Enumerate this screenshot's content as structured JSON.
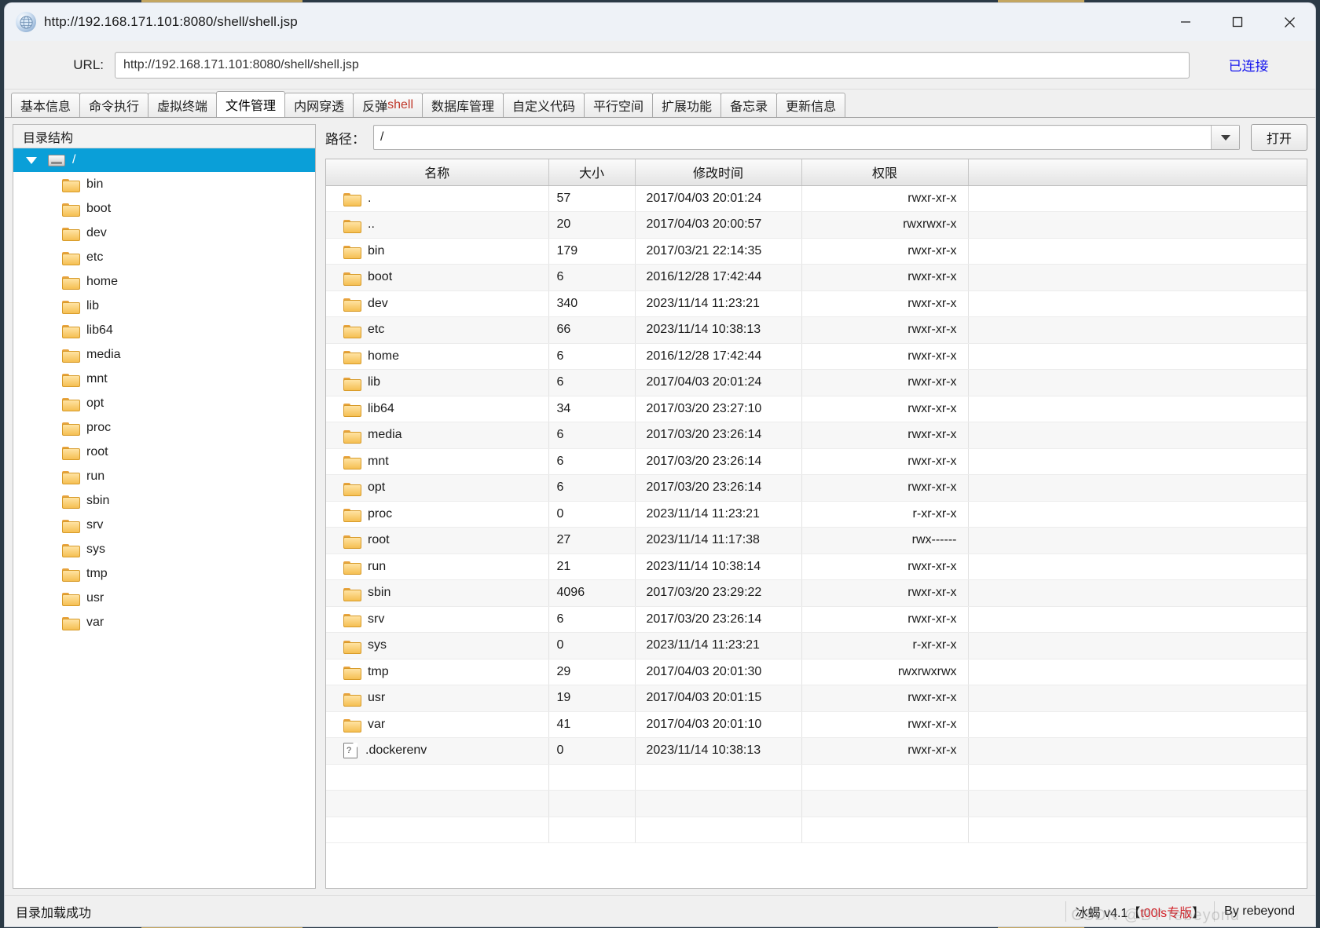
{
  "window": {
    "title": "http://192.168.171.101:8080/shell/shell.jsp",
    "app_icon": "globe-icon",
    "minimize_label": "—",
    "maximize_label": "▢",
    "close_label": "✕"
  },
  "url_bar": {
    "label": "URL:",
    "value": "http://192.168.171.101:8080/shell/shell.jsp",
    "placeholder": "http://",
    "status": "已连接"
  },
  "tabs": [
    {
      "label": "基本信息",
      "active": false
    },
    {
      "label": "命令执行",
      "active": false
    },
    {
      "label": "虚拟终端",
      "active": false
    },
    {
      "label": "文件管理",
      "active": true
    },
    {
      "label": "内网穿透",
      "active": false
    },
    {
      "label": "反弹shell",
      "active": false,
      "red_part": "shell",
      "plain_part": "反弹"
    },
    {
      "label": "数据库管理",
      "active": false
    },
    {
      "label": "自定义代码",
      "active": false
    },
    {
      "label": "平行空间",
      "active": false
    },
    {
      "label": "扩展功能",
      "active": false
    },
    {
      "label": "备忘录",
      "active": false
    },
    {
      "label": "更新信息",
      "active": false
    }
  ],
  "tree": {
    "title": "目录结构",
    "root": {
      "label": "/",
      "icon": "drive-icon",
      "expanded": true,
      "selected": true
    },
    "items": [
      {
        "label": "bin",
        "icon": "folder-icon"
      },
      {
        "label": "boot",
        "icon": "folder-icon"
      },
      {
        "label": "dev",
        "icon": "folder-icon"
      },
      {
        "label": "etc",
        "icon": "folder-icon"
      },
      {
        "label": "home",
        "icon": "folder-icon"
      },
      {
        "label": "lib",
        "icon": "folder-icon"
      },
      {
        "label": "lib64",
        "icon": "folder-icon"
      },
      {
        "label": "media",
        "icon": "folder-icon"
      },
      {
        "label": "mnt",
        "icon": "folder-icon"
      },
      {
        "label": "opt",
        "icon": "folder-icon"
      },
      {
        "label": "proc",
        "icon": "folder-icon"
      },
      {
        "label": "root",
        "icon": "folder-icon"
      },
      {
        "label": "run",
        "icon": "folder-icon"
      },
      {
        "label": "sbin",
        "icon": "folder-icon"
      },
      {
        "label": "srv",
        "icon": "folder-icon"
      },
      {
        "label": "sys",
        "icon": "folder-icon"
      },
      {
        "label": "tmp",
        "icon": "folder-icon"
      },
      {
        "label": "usr",
        "icon": "folder-icon"
      },
      {
        "label": "var",
        "icon": "folder-icon"
      }
    ]
  },
  "path_bar": {
    "label": "路径：",
    "value": "/",
    "dropdown_icon": "chevron-down-icon",
    "open_button": "打开"
  },
  "file_table": {
    "columns": [
      "名称",
      "大小",
      "修改时间",
      "权限",
      ""
    ],
    "rows": [
      {
        "icon": "folder-icon",
        "name": ".",
        "size": "57",
        "mtime": "2017/04/03 20:01:24",
        "perm": "rwxr-xr-x"
      },
      {
        "icon": "folder-icon",
        "name": "..",
        "size": "20",
        "mtime": "2017/04/03 20:00:57",
        "perm": "rwxrwxr-x"
      },
      {
        "icon": "folder-icon",
        "name": "bin",
        "size": "179",
        "mtime": "2017/03/21 22:14:35",
        "perm": "rwxr-xr-x"
      },
      {
        "icon": "folder-icon",
        "name": "boot",
        "size": "6",
        "mtime": "2016/12/28 17:42:44",
        "perm": "rwxr-xr-x"
      },
      {
        "icon": "folder-icon",
        "name": "dev",
        "size": "340",
        "mtime": "2023/11/14 11:23:21",
        "perm": "rwxr-xr-x"
      },
      {
        "icon": "folder-icon",
        "name": "etc",
        "size": "66",
        "mtime": "2023/11/14 10:38:13",
        "perm": "rwxr-xr-x"
      },
      {
        "icon": "folder-icon",
        "name": "home",
        "size": "6",
        "mtime": "2016/12/28 17:42:44",
        "perm": "rwxr-xr-x"
      },
      {
        "icon": "folder-icon",
        "name": "lib",
        "size": "6",
        "mtime": "2017/04/03 20:01:24",
        "perm": "rwxr-xr-x"
      },
      {
        "icon": "folder-icon",
        "name": "lib64",
        "size": "34",
        "mtime": "2017/03/20 23:27:10",
        "perm": "rwxr-xr-x"
      },
      {
        "icon": "folder-icon",
        "name": "media",
        "size": "6",
        "mtime": "2017/03/20 23:26:14",
        "perm": "rwxr-xr-x"
      },
      {
        "icon": "folder-icon",
        "name": "mnt",
        "size": "6",
        "mtime": "2017/03/20 23:26:14",
        "perm": "rwxr-xr-x"
      },
      {
        "icon": "folder-icon",
        "name": "opt",
        "size": "6",
        "mtime": "2017/03/20 23:26:14",
        "perm": "rwxr-xr-x"
      },
      {
        "icon": "folder-icon",
        "name": "proc",
        "size": "0",
        "mtime": "2023/11/14 11:23:21",
        "perm": "r-xr-xr-x"
      },
      {
        "icon": "folder-icon",
        "name": "root",
        "size": "27",
        "mtime": "2023/11/14 11:17:38",
        "perm": "rwx------"
      },
      {
        "icon": "folder-icon",
        "name": "run",
        "size": "21",
        "mtime": "2023/11/14 10:38:14",
        "perm": "rwxr-xr-x"
      },
      {
        "icon": "folder-icon",
        "name": "sbin",
        "size": "4096",
        "mtime": "2017/03/20 23:29:22",
        "perm": "rwxr-xr-x"
      },
      {
        "icon": "folder-icon",
        "name": "srv",
        "size": "6",
        "mtime": "2017/03/20 23:26:14",
        "perm": "rwxr-xr-x"
      },
      {
        "icon": "folder-icon",
        "name": "sys",
        "size": "0",
        "mtime": "2023/11/14 11:23:21",
        "perm": "r-xr-xr-x"
      },
      {
        "icon": "folder-icon",
        "name": "tmp",
        "size": "29",
        "mtime": "2017/04/03 20:01:30",
        "perm": "rwxrwxrwx"
      },
      {
        "icon": "folder-icon",
        "name": "usr",
        "size": "19",
        "mtime": "2017/04/03 20:01:15",
        "perm": "rwxr-xr-x"
      },
      {
        "icon": "folder-icon",
        "name": "var",
        "size": "41",
        "mtime": "2017/04/03 20:01:10",
        "perm": "rwxr-xr-x"
      },
      {
        "icon": "file-icon",
        "name": ".dockerenv",
        "size": "0",
        "mtime": "2023/11/14 10:38:13",
        "perm": "rwxr-xr-x"
      }
    ]
  },
  "status_bar": {
    "message": "目录加载成功",
    "brand_prefix": "冰蝎 v4.1【",
    "brand_red": "t00ls专版",
    "brand_suffix": "】",
    "author": "By rebeyond",
    "watermark": "CSDN @BY rebeyond"
  },
  "colors": {
    "selection": "#0a9fd8",
    "link": "#1414ee",
    "brand_red": "#d2232a",
    "tab_red": "#c0392b"
  }
}
